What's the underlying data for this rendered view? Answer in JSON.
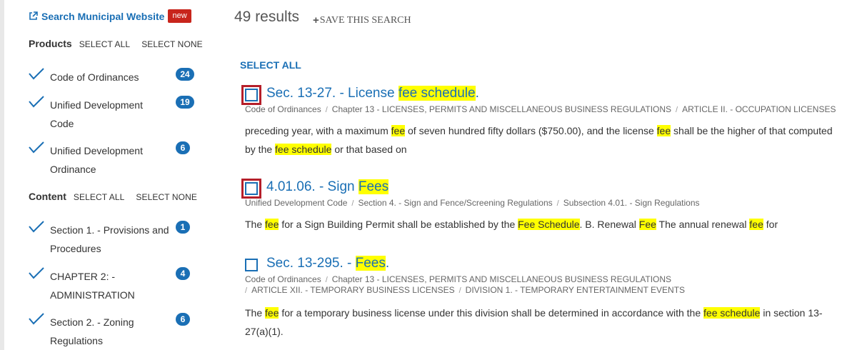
{
  "sidebar": {
    "search_link": {
      "label": "Search Municipal Website",
      "badge": "new"
    },
    "products": {
      "title": "Products",
      "select_all": "SELECT ALL",
      "select_none": "SELECT NONE",
      "items": [
        {
          "label": "Code of Ordinances",
          "count": "24",
          "checked": true
        },
        {
          "label": "Unified Development Code",
          "count": "19",
          "checked": true
        },
        {
          "label": "Unified Development Ordinance",
          "count": "6",
          "checked": true
        }
      ]
    },
    "content": {
      "title": "Content",
      "select_all": "SELECT ALL",
      "select_none": "SELECT NONE",
      "items": [
        {
          "label": "Section 1. - Provisions and Procedures",
          "count": "1",
          "checked": true
        },
        {
          "label": "CHAPTER 2: - ADMINISTRATION",
          "count": "4",
          "checked": true
        },
        {
          "label": "Section 2. - Zoning Regulations",
          "count": "6",
          "checked": true
        }
      ]
    }
  },
  "main": {
    "results_count": "49 results",
    "save_search": "SAVE THIS SEARCH",
    "select_all": "SELECT ALL",
    "results": [
      {
        "title_plain": "Sec. 13-27. - License ",
        "title_highlight": "fee schedule",
        "title_tail": ".",
        "crumbs": [
          "Code of Ordinances",
          "Chapter 13 - LICENSES, PERMITS AND MISCELLANEOUS BUSINESS REGULATIONS",
          "ARTICLE II. - OCCUPATION LICENSES"
        ],
        "snippet": [
          [
            "preceding year, with a maximum ",
            false
          ],
          [
            "fee",
            true
          ],
          [
            " of seven hundred fifty dollars ($750.00), and the license ",
            false
          ],
          [
            "fee",
            true
          ],
          [
            " shall be the higher of that computed by the ",
            false
          ],
          [
            "fee schedule",
            true
          ],
          [
            " or that based on",
            false
          ]
        ]
      },
      {
        "title_plain": "4.01.06. - Sign ",
        "title_highlight": "Fees",
        "title_tail": "",
        "crumbs": [
          "Unified Development Code",
          "Section 4. - Sign and Fence/Screening Regulations",
          "Subsection 4.01. - Sign Regulations"
        ],
        "snippet": [
          [
            "The ",
            false
          ],
          [
            "fee",
            true
          ],
          [
            " for a Sign Building Permit shall be established by the ",
            false
          ],
          [
            "Fee Schedule",
            true
          ],
          [
            ". B. Renewal ",
            false
          ],
          [
            "Fee",
            true
          ],
          [
            " The annual renewal ",
            false
          ],
          [
            "fee",
            true
          ],
          [
            " for",
            false
          ]
        ]
      },
      {
        "title_plain": "Sec. 13-295. - ",
        "title_highlight": "Fees",
        "title_tail": ".",
        "crumbs_line1": [
          "Code of Ordinances",
          "Chapter 13 - LICENSES, PERMITS AND MISCELLANEOUS BUSINESS REGULATIONS"
        ],
        "crumbs_line2": [
          "ARTICLE XII. - TEMPORARY BUSINESS LICENSES",
          "DIVISION 1. - TEMPORARY ENTERTAINMENT EVENTS"
        ],
        "snippet": [
          [
            "The ",
            false
          ],
          [
            "fee",
            true
          ],
          [
            " for a temporary business license under this division shall be determined in accordance with the ",
            false
          ],
          [
            "fee schedule",
            true
          ],
          [
            " in section 13-27(a)(1).",
            false
          ]
        ]
      }
    ]
  },
  "colors": {
    "link": "#1a6fb5",
    "highlight": "#ffff00",
    "badge_new": "#c8251c",
    "focus_outline": "#b51f2a"
  }
}
